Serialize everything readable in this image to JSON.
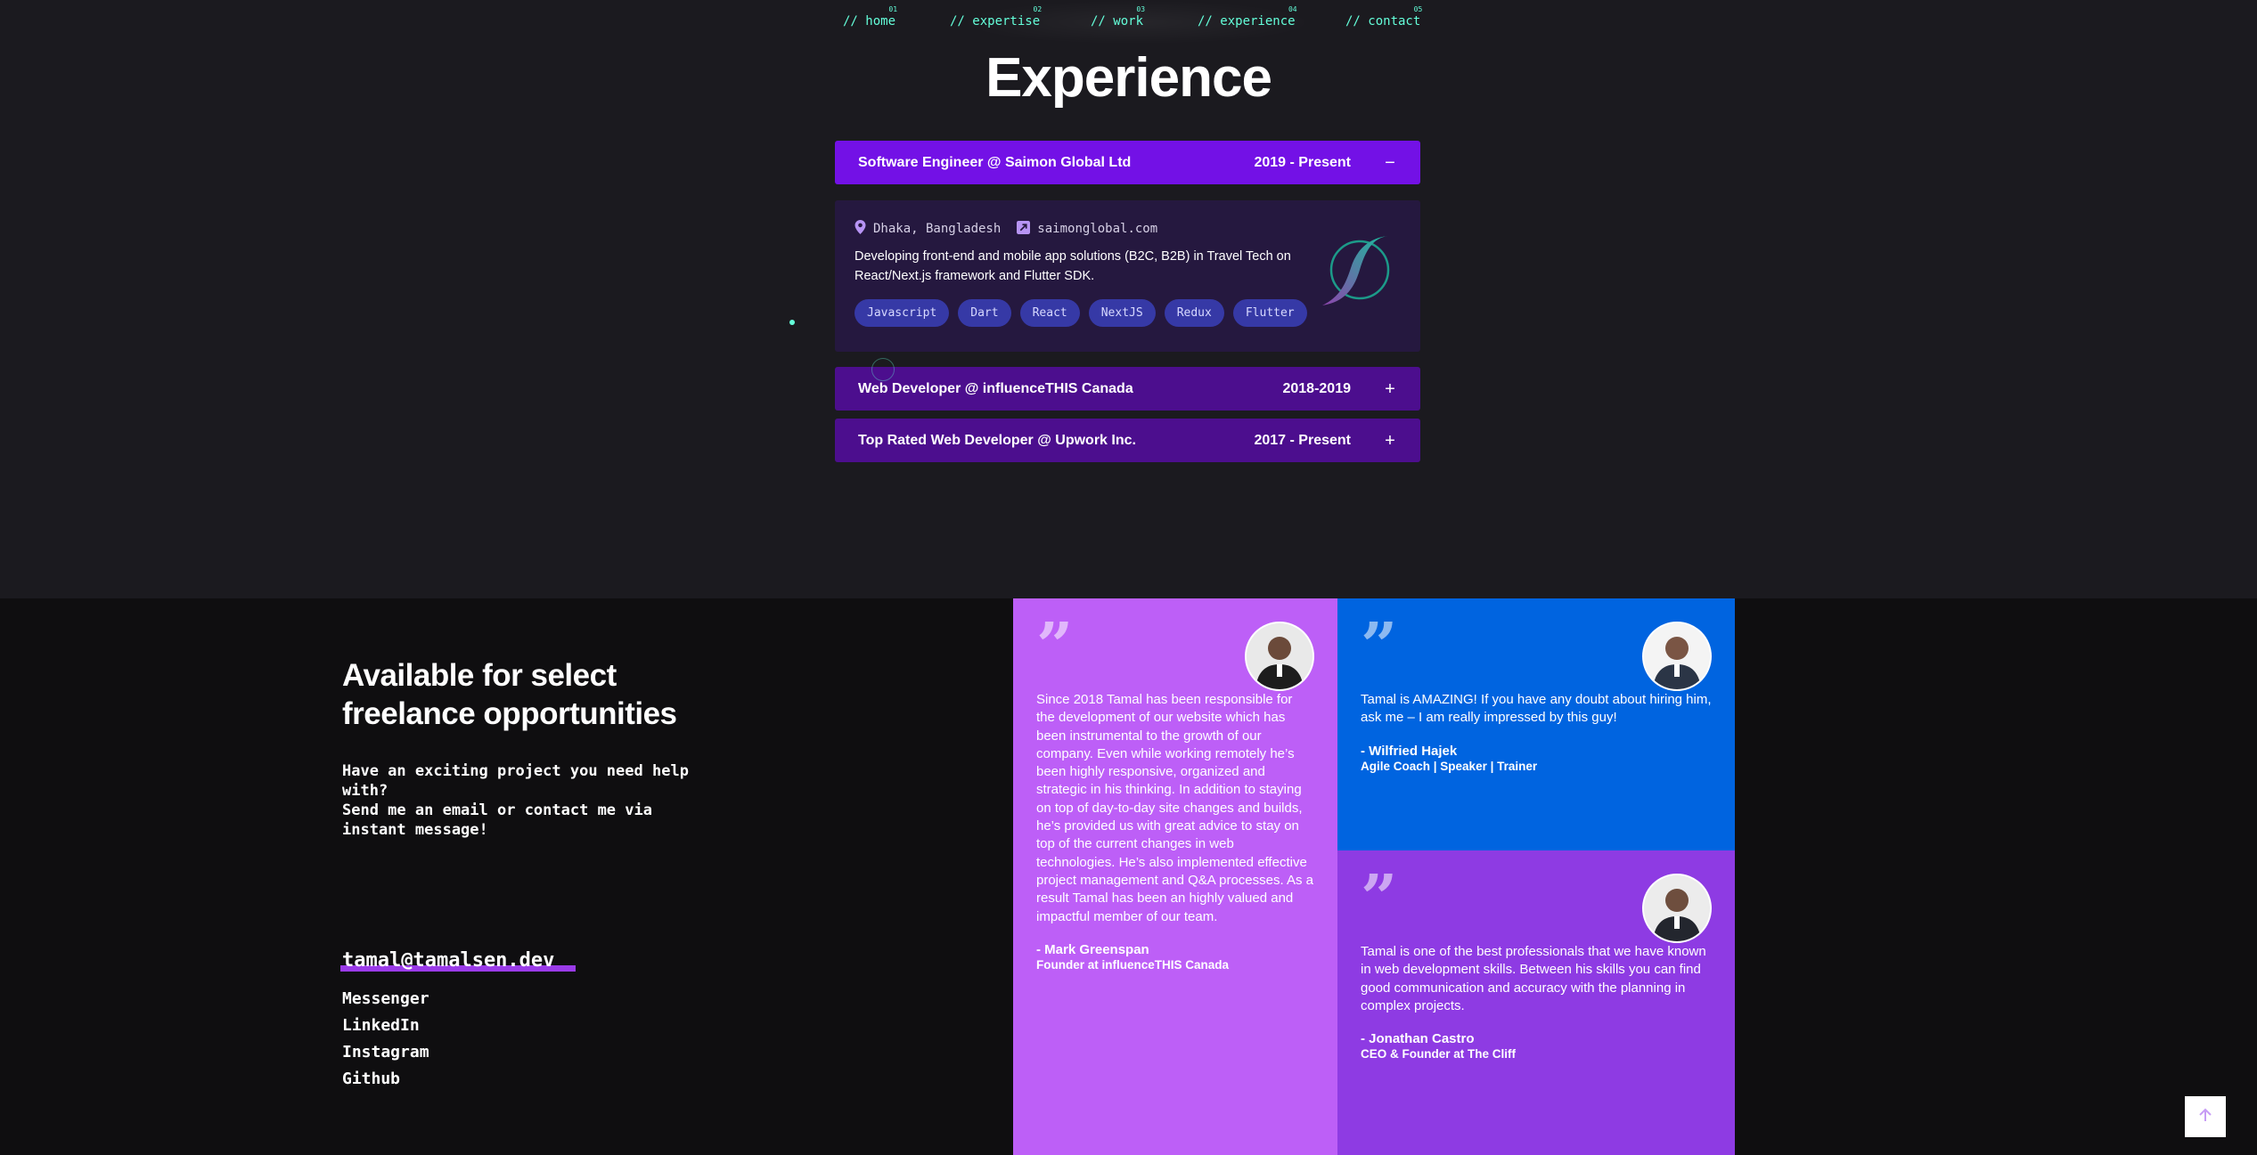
{
  "nav": {
    "items": [
      {
        "num": "01",
        "label": "// home"
      },
      {
        "num": "02",
        "label": "// expertise"
      },
      {
        "num": "03",
        "label": "// work"
      },
      {
        "num": "04",
        "label": "// experience"
      },
      {
        "num": "05",
        "label": "// contact"
      }
    ]
  },
  "experience": {
    "title": "Experience",
    "jobs": [
      {
        "title": "Software Engineer @ Saimon Global Ltd",
        "date": "2019 - Present",
        "toggle": "−",
        "location": "Dhaka, Bangladesh",
        "website": "saimonglobal.com",
        "description": "Developing front-end and mobile app solutions (B2C, B2B) in Travel Tech on React/Next.js framework and Flutter SDK.",
        "tags": [
          "Javascript",
          "Dart",
          "React",
          "NextJS",
          "Redux",
          "Flutter"
        ]
      },
      {
        "title": "Web Developer @ influenceTHIS Canada",
        "date": "2018-2019",
        "toggle": "+"
      },
      {
        "title": "Top Rated Web Developer @ Upwork Inc.",
        "date": "2017 - Present",
        "toggle": "+"
      }
    ]
  },
  "contact": {
    "heading": "Available for select freelance opportunities",
    "pitch": "Have an exciting project you need help with?\nSend me an email or contact me via instant message!",
    "email": "tamal@tamalsen.dev",
    "links": [
      "Messenger",
      "LinkedIn",
      "Instagram",
      "Github"
    ]
  },
  "testimonials": [
    {
      "quote": "Since 2018 Tamal has been responsible for the development of our website which has been instrumental to the growth of our company. Even while working remotely he’s been highly responsive, organized and strategic in his thinking. In addition to staying on top of day-to-day site changes and builds, he’s provided us with great advice to stay on top of the current changes in web technologies. He’s also implemented effective project management and Q&A processes. As a result Tamal has been an highly valued and impactful member of our team.",
      "author": "- Mark Greenspan",
      "role": "Founder at influenceTHIS Canada",
      "color": "#bd5ff7"
    },
    {
      "quote": "Tamal is AMAZING! If you have any doubt about hiring him, ask me – I am really impressed by this guy!",
      "author": "- Wilfried Hajek",
      "role": "Agile Coach | Speaker | Trainer",
      "color": "#0064e0"
    },
    {
      "quote": "Tamal is one of the best professionals that we have known in web development skills. Between his skills you can find good communication and accuracy with the planning in complex projects.",
      "author": "- Jonathan Castro",
      "role": "CEO & Founder at The Cliff",
      "color": "#8e3be3"
    }
  ],
  "icons": {
    "quote": "quote-icon",
    "location": "map-pin-icon",
    "website": "link-icon",
    "scroll_top": "arrow-up-icon"
  },
  "colors": {
    "accent": "#64ffda",
    "active_accordion": "#7311e6",
    "collapsed_accordion": "#4c0e8e",
    "tag_bg": "#3639a6",
    "email_underline": "#9a3be8"
  }
}
